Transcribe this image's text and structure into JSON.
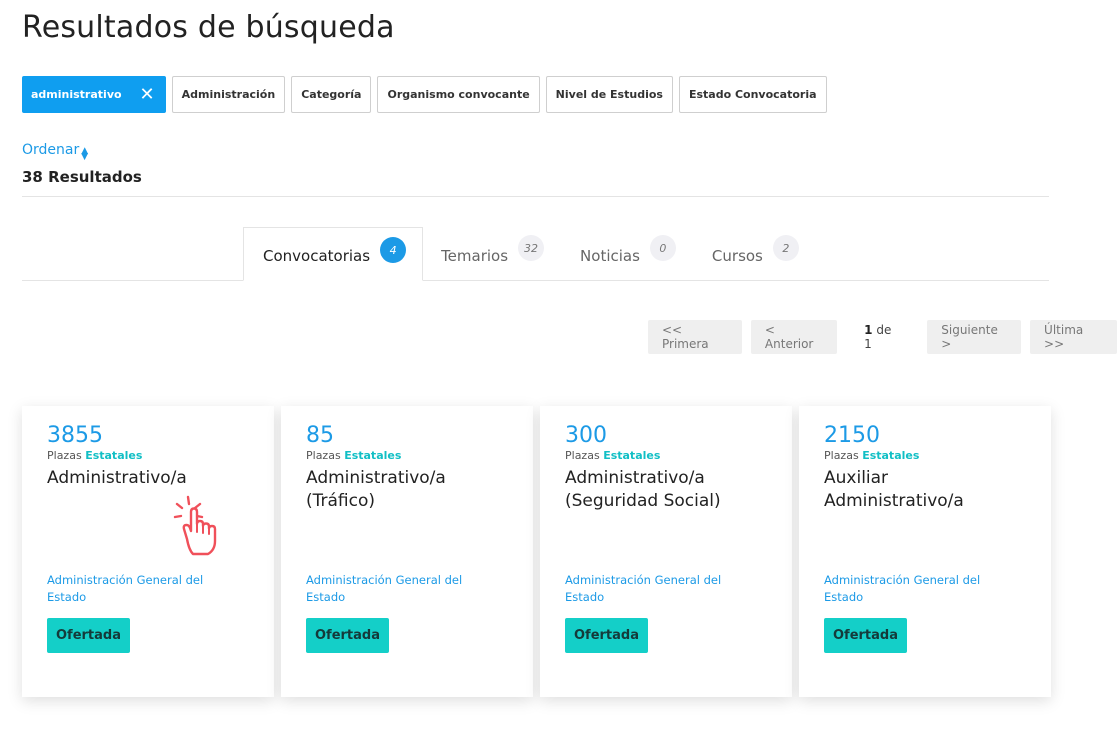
{
  "page_title": "Resultados de búsqueda",
  "filters": {
    "active_chip": {
      "label": "administrativo",
      "remove_icon": "close-icon"
    },
    "chips": [
      "Administración",
      "Categoría",
      "Organismo convocante",
      "Nivel de Estudios",
      "Estado Convocatoria"
    ]
  },
  "sort": {
    "label": "Ordenar",
    "icon": "sort-caret-icon"
  },
  "results_count": "38 Resultados",
  "tabs": [
    {
      "label": "Convocatorias",
      "count": "4"
    },
    {
      "label": "Temarios",
      "count": "32"
    },
    {
      "label": "Noticias",
      "count": "0"
    },
    {
      "label": "Cursos",
      "count": "2"
    }
  ],
  "active_tab": "Convocatorias",
  "pagination": {
    "first": "<< Primera",
    "prev": "< Anterior",
    "current": "1",
    "sep": "de",
    "total": "1",
    "next": "Siguiente >",
    "last": "Última >>"
  },
  "cards": [
    {
      "number": "3855",
      "plazas": "Plazas",
      "scope": "Estatales",
      "title": "Administrativo/a",
      "org": "Administración General del Estado",
      "status": "Ofertada"
    },
    {
      "number": "85",
      "plazas": "Plazas",
      "scope": "Estatales",
      "title": "Administrativo/a (Tráfico)",
      "org": "Administración General del Estado",
      "status": "Ofertada"
    },
    {
      "number": "300",
      "plazas": "Plazas",
      "scope": "Estatales",
      "title": "Administrativo/a (Seguridad Social)",
      "org": "Administración General del Estado",
      "status": "Ofertada"
    },
    {
      "number": "2150",
      "plazas": "Plazas",
      "scope": "Estatales",
      "title": "Auxiliar Administrativo/a",
      "org": "Administración General del Estado",
      "status": "Ofertada"
    }
  ],
  "colors": {
    "accent": "#1c9ae6",
    "teal": "#14cfc8",
    "cursor": "#f0505a"
  },
  "overlay_icon": "hand-pointer-click-icon"
}
